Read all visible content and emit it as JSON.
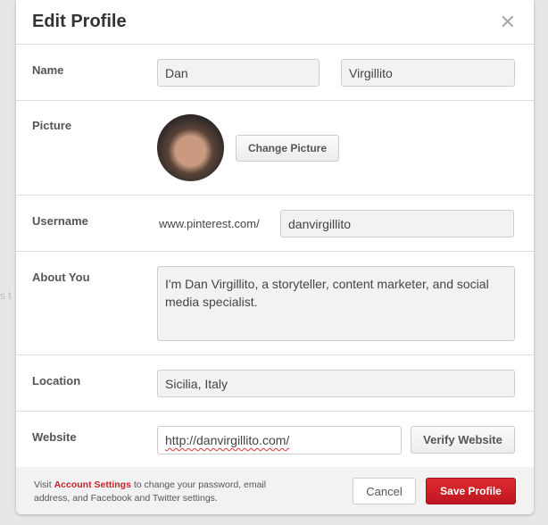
{
  "background": {
    "ghost_text": "s t"
  },
  "dialog": {
    "title": "Edit Profile",
    "close_icon": "close-icon",
    "name": {
      "label": "Name",
      "first": "Dan",
      "last": "Virgillito"
    },
    "picture": {
      "label": "Picture",
      "change_button": "Change Picture"
    },
    "username": {
      "label": "Username",
      "prefix": "www.pinterest.com/",
      "value": "danvirgillito"
    },
    "about": {
      "label": "About You",
      "value": "I'm Dan Virgillito, a storyteller, content marketer, and social media specialist."
    },
    "location": {
      "label": "Location",
      "value": "Sicilia, Italy"
    },
    "website": {
      "label": "Website",
      "value": "http://danvirgillito.com/",
      "verify_button": "Verify Website"
    },
    "footer": {
      "note_prefix": "Visit ",
      "note_link": "Account Settings",
      "note_suffix": " to change your password, email address, and Facebook and Twitter settings.",
      "cancel": "Cancel",
      "save": "Save Profile"
    }
  },
  "colors": {
    "accent": "#cb2027",
    "background": "#e6e7e7"
  }
}
